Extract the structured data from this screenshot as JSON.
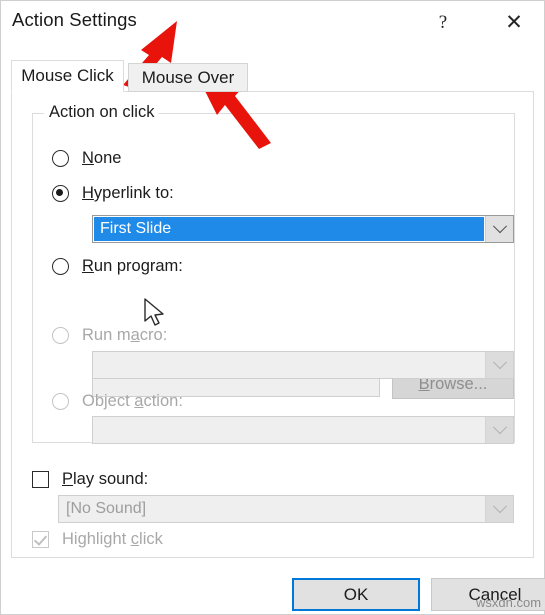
{
  "window": {
    "title": "Action Settings",
    "help_label": "?",
    "close_label": "✕"
  },
  "tabs": [
    {
      "label": "Mouse Click",
      "active": true
    },
    {
      "label": "Mouse Over",
      "active": false
    }
  ],
  "group": {
    "legend": "Action on click",
    "options": [
      {
        "id": "none",
        "label_pre": "",
        "label_key": "N",
        "label_post": "one",
        "selected": false,
        "enabled": true
      },
      {
        "id": "hyperlink-to",
        "label_pre": "",
        "label_key": "H",
        "label_post": "yperlink to:",
        "selected": true,
        "enabled": true
      },
      {
        "id": "run-program",
        "label_pre": "",
        "label_key": "R",
        "label_post": "un program:",
        "selected": false,
        "enabled": true
      },
      {
        "id": "run-macro",
        "label_pre": "Run m",
        "label_key": "a",
        "label_post": "cro:",
        "selected": false,
        "enabled": false
      },
      {
        "id": "object-action",
        "label_pre": "Object ",
        "label_key": "a",
        "label_post": "ction:",
        "selected": false,
        "enabled": false
      }
    ]
  },
  "controls": {
    "hyperlink_combo": {
      "value": "First Slide",
      "enabled": true,
      "highlighted": true
    },
    "run_program_input": {
      "value": "",
      "placeholder": "",
      "enabled": false
    },
    "browse_button": {
      "label_pre": "",
      "label_key": "B",
      "label_post": "rowse...",
      "enabled": false
    },
    "run_macro_combo": {
      "value": "",
      "enabled": false
    },
    "object_action_combo": {
      "value": "",
      "enabled": false
    },
    "play_sound_checkbox": {
      "label_pre": "",
      "label_key": "P",
      "label_post": "lay sound:",
      "checked": false,
      "enabled": true
    },
    "sound_combo": {
      "value": "[No Sound]",
      "enabled": false
    },
    "highlight_click_checkbox": {
      "label_pre": "Highlight ",
      "label_key": "c",
      "label_post": "lick",
      "checked": true,
      "enabled": false
    }
  },
  "footer": {
    "ok_label": "OK",
    "cancel_label": "Cancel"
  },
  "watermark": "wsxdn.com",
  "colors": {
    "selection_blue": "#1f8ae8",
    "focus_blue": "#0078d7",
    "annotation_red": "#e8140c",
    "dialog_bg": "#ffffff",
    "disabled_text": "#a8a8a8"
  },
  "annotations": [
    {
      "name": "arrow-to-mouse-click-tab",
      "color": "#e8140c"
    },
    {
      "name": "arrow-to-mouse-over-tab",
      "color": "#e8140c"
    }
  ]
}
